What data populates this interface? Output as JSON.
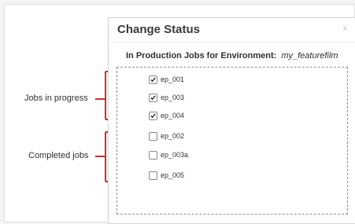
{
  "dialog": {
    "title": "Change Status",
    "close_symbol": "x",
    "environment_label": "In Production Jobs for Environment:",
    "environment_value": "my_featurefilm"
  },
  "jobs": [
    {
      "label": "ep_001",
      "checked": true
    },
    {
      "label": "ep_003",
      "checked": true
    },
    {
      "label": "ep_004",
      "checked": true
    },
    {
      "label": "ep_002",
      "checked": false
    },
    {
      "label": "ep_003a",
      "checked": false
    },
    {
      "label": "ep_005",
      "checked": false
    }
  ],
  "annotations": {
    "jobs_in_progress": "Jobs in progress",
    "completed_jobs": "Completed jobs"
  },
  "colors": {
    "callout": "#d22a2a",
    "check": "#202020"
  },
  "icons": {
    "close": "close-icon",
    "checked": "checkmark-icon"
  }
}
